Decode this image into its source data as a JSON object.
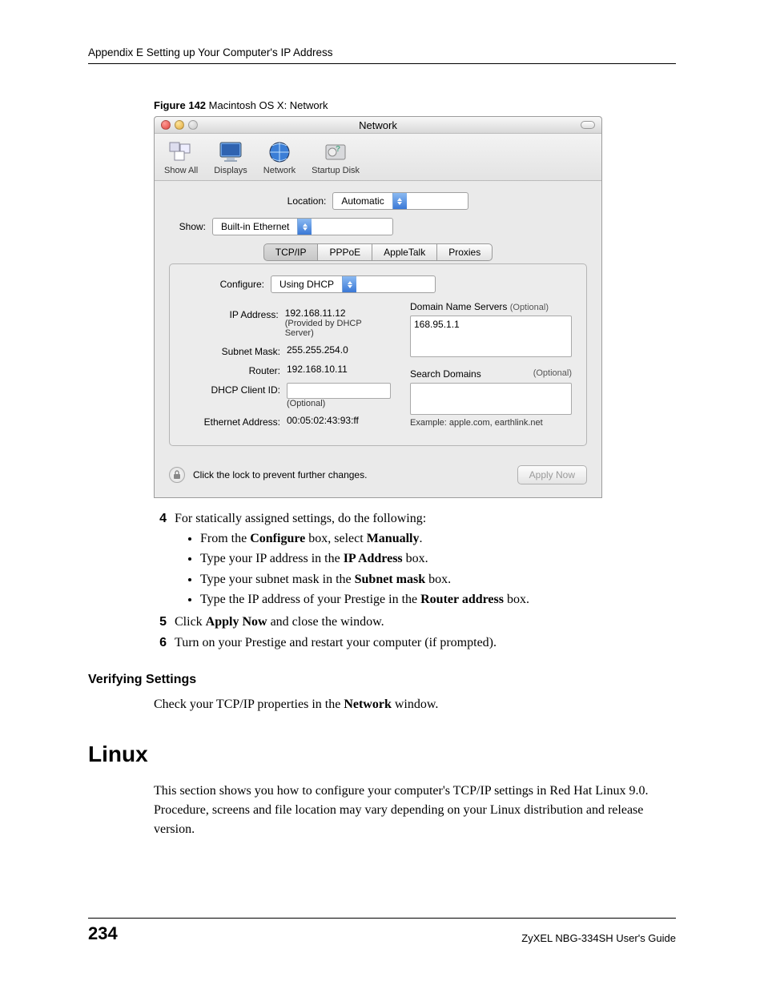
{
  "header": {
    "text": "Appendix E Setting up Your Computer's IP Address"
  },
  "figure": {
    "label_bold": "Figure 142",
    "label_rest": "   Macintosh OS X: Network"
  },
  "mac": {
    "title": "Network",
    "toolbar": {
      "show_all": "Show All",
      "displays": "Displays",
      "network": "Network",
      "startup_disk": "Startup Disk"
    },
    "location_label": "Location:",
    "location_value": "Automatic",
    "show_label": "Show:",
    "show_value": "Built-in Ethernet",
    "tabs": {
      "tcpip": "TCP/IP",
      "pppoe": "PPPoE",
      "appletalk": "AppleTalk",
      "proxies": "Proxies"
    },
    "configure_label": "Configure:",
    "configure_value": "Using DHCP",
    "ip_label": "IP Address:",
    "ip_value": "192.168.11.12",
    "ip_note": "(Provided by DHCP Server)",
    "subnet_label": "Subnet Mask:",
    "subnet_value": "255.255.254.0",
    "router_label": "Router:",
    "router_value": "192.168.10.11",
    "dhcp_label": "DHCP Client ID:",
    "dhcp_note": "(Optional)",
    "eth_label": "Ethernet Address:",
    "eth_value": "00:05:02:43:93:ff",
    "dns_label": "Domain Name Servers",
    "dns_optional": "(Optional)",
    "dns_value": "168.95.1.1",
    "search_label": "Search Domains",
    "search_optional": "(Optional)",
    "example_label": "Example: apple.com, earthlink.net",
    "lock_text": "Click the lock to prevent further changes.",
    "apply_label": "Apply Now"
  },
  "steps": {
    "n4": "4",
    "s4_intro": "For statically assigned settings, do the following:",
    "s4_b1_a": "From the ",
    "s4_b1_b": "Configure",
    "s4_b1_c": " box, select ",
    "s4_b1_d": "Manually",
    "s4_b1_e": ".",
    "s4_b2_a": "Type your IP address in the ",
    "s4_b2_b": "IP Address",
    "s4_b2_c": " box.",
    "s4_b3_a": "Type your subnet mask in the ",
    "s4_b3_b": "Subnet mask",
    "s4_b3_c": " box.",
    "s4_b4_a": "Type the IP address of your Prestige in the ",
    "s4_b4_b": "Router address",
    "s4_b4_c": " box.",
    "n5": "5",
    "s5_a": "Click ",
    "s5_b": "Apply Now",
    "s5_c": " and close the window.",
    "n6": "6",
    "s6": "Turn on your Prestige and restart your computer (if prompted)."
  },
  "verify": {
    "heading": "Verifying Settings",
    "text_a": "Check your TCP/IP properties in the ",
    "text_b": "Network",
    "text_c": " window."
  },
  "linux": {
    "heading": "Linux",
    "para": "This section shows you how to configure your computer's TCP/IP settings in Red Hat Linux 9.0. Procedure, screens and file location may vary depending on your Linux distribution and release version."
  },
  "footer": {
    "page": "234",
    "guide": "ZyXEL NBG-334SH User's Guide"
  }
}
